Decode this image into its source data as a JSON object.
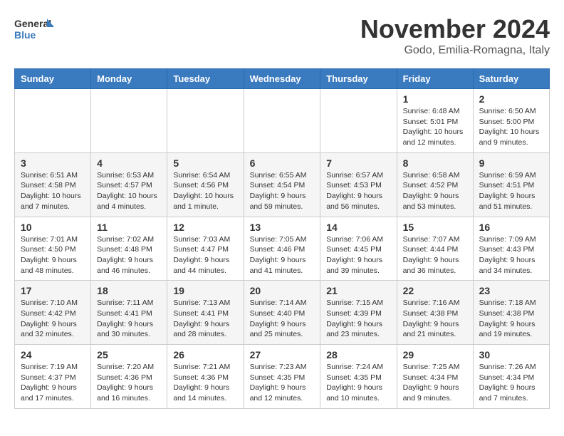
{
  "logo": {
    "text_general": "General",
    "text_blue": "Blue"
  },
  "title": {
    "month": "November 2024",
    "location": "Godo, Emilia-Romagna, Italy"
  },
  "weekdays": [
    "Sunday",
    "Monday",
    "Tuesday",
    "Wednesday",
    "Thursday",
    "Friday",
    "Saturday"
  ],
  "weeks": [
    [
      {
        "day": "",
        "info": ""
      },
      {
        "day": "",
        "info": ""
      },
      {
        "day": "",
        "info": ""
      },
      {
        "day": "",
        "info": ""
      },
      {
        "day": "",
        "info": ""
      },
      {
        "day": "1",
        "info": "Sunrise: 6:48 AM\nSunset: 5:01 PM\nDaylight: 10 hours and 12 minutes."
      },
      {
        "day": "2",
        "info": "Sunrise: 6:50 AM\nSunset: 5:00 PM\nDaylight: 10 hours and 9 minutes."
      }
    ],
    [
      {
        "day": "3",
        "info": "Sunrise: 6:51 AM\nSunset: 4:58 PM\nDaylight: 10 hours and 7 minutes."
      },
      {
        "day": "4",
        "info": "Sunrise: 6:53 AM\nSunset: 4:57 PM\nDaylight: 10 hours and 4 minutes."
      },
      {
        "day": "5",
        "info": "Sunrise: 6:54 AM\nSunset: 4:56 PM\nDaylight: 10 hours and 1 minute."
      },
      {
        "day": "6",
        "info": "Sunrise: 6:55 AM\nSunset: 4:54 PM\nDaylight: 9 hours and 59 minutes."
      },
      {
        "day": "7",
        "info": "Sunrise: 6:57 AM\nSunset: 4:53 PM\nDaylight: 9 hours and 56 minutes."
      },
      {
        "day": "8",
        "info": "Sunrise: 6:58 AM\nSunset: 4:52 PM\nDaylight: 9 hours and 53 minutes."
      },
      {
        "day": "9",
        "info": "Sunrise: 6:59 AM\nSunset: 4:51 PM\nDaylight: 9 hours and 51 minutes."
      }
    ],
    [
      {
        "day": "10",
        "info": "Sunrise: 7:01 AM\nSunset: 4:50 PM\nDaylight: 9 hours and 48 minutes."
      },
      {
        "day": "11",
        "info": "Sunrise: 7:02 AM\nSunset: 4:48 PM\nDaylight: 9 hours and 46 minutes."
      },
      {
        "day": "12",
        "info": "Sunrise: 7:03 AM\nSunset: 4:47 PM\nDaylight: 9 hours and 44 minutes."
      },
      {
        "day": "13",
        "info": "Sunrise: 7:05 AM\nSunset: 4:46 PM\nDaylight: 9 hours and 41 minutes."
      },
      {
        "day": "14",
        "info": "Sunrise: 7:06 AM\nSunset: 4:45 PM\nDaylight: 9 hours and 39 minutes."
      },
      {
        "day": "15",
        "info": "Sunrise: 7:07 AM\nSunset: 4:44 PM\nDaylight: 9 hours and 36 minutes."
      },
      {
        "day": "16",
        "info": "Sunrise: 7:09 AM\nSunset: 4:43 PM\nDaylight: 9 hours and 34 minutes."
      }
    ],
    [
      {
        "day": "17",
        "info": "Sunrise: 7:10 AM\nSunset: 4:42 PM\nDaylight: 9 hours and 32 minutes."
      },
      {
        "day": "18",
        "info": "Sunrise: 7:11 AM\nSunset: 4:41 PM\nDaylight: 9 hours and 30 minutes."
      },
      {
        "day": "19",
        "info": "Sunrise: 7:13 AM\nSunset: 4:41 PM\nDaylight: 9 hours and 28 minutes."
      },
      {
        "day": "20",
        "info": "Sunrise: 7:14 AM\nSunset: 4:40 PM\nDaylight: 9 hours and 25 minutes."
      },
      {
        "day": "21",
        "info": "Sunrise: 7:15 AM\nSunset: 4:39 PM\nDaylight: 9 hours and 23 minutes."
      },
      {
        "day": "22",
        "info": "Sunrise: 7:16 AM\nSunset: 4:38 PM\nDaylight: 9 hours and 21 minutes."
      },
      {
        "day": "23",
        "info": "Sunrise: 7:18 AM\nSunset: 4:38 PM\nDaylight: 9 hours and 19 minutes."
      }
    ],
    [
      {
        "day": "24",
        "info": "Sunrise: 7:19 AM\nSunset: 4:37 PM\nDaylight: 9 hours and 17 minutes."
      },
      {
        "day": "25",
        "info": "Sunrise: 7:20 AM\nSunset: 4:36 PM\nDaylight: 9 hours and 16 minutes."
      },
      {
        "day": "26",
        "info": "Sunrise: 7:21 AM\nSunset: 4:36 PM\nDaylight: 9 hours and 14 minutes."
      },
      {
        "day": "27",
        "info": "Sunrise: 7:23 AM\nSunset: 4:35 PM\nDaylight: 9 hours and 12 minutes."
      },
      {
        "day": "28",
        "info": "Sunrise: 7:24 AM\nSunset: 4:35 PM\nDaylight: 9 hours and 10 minutes."
      },
      {
        "day": "29",
        "info": "Sunrise: 7:25 AM\nSunset: 4:34 PM\nDaylight: 9 hours and 9 minutes."
      },
      {
        "day": "30",
        "info": "Sunrise: 7:26 AM\nSunset: 4:34 PM\nDaylight: 9 hours and 7 minutes."
      }
    ]
  ]
}
